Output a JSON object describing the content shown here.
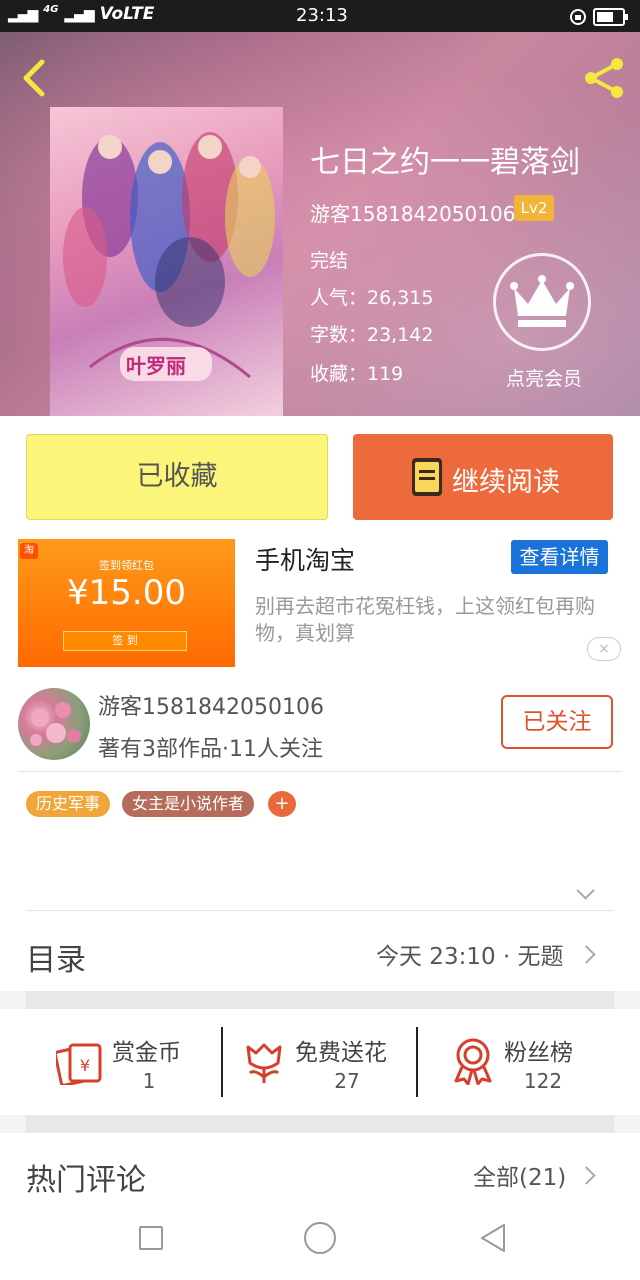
{
  "status_bar": {
    "network": "VoLTE",
    "signal_label": "4G",
    "time": "23:13"
  },
  "book": {
    "title": "七日之约一一碧落剑",
    "author": "游客1581842050106",
    "level": "Lv2",
    "status": "完结",
    "popularity": "人气：26,315",
    "word_count": "字数：23,142",
    "favorites": "收藏：119",
    "cover_logo": "叶罗丽"
  },
  "vip": {
    "label": "点亮会员"
  },
  "actions": {
    "collected": "已收藏",
    "continue_reading": "继续阅读"
  },
  "ad": {
    "title": "手机淘宝",
    "button": "查看详情",
    "description": "别再去超市花冤枉钱，上这领红包再购物，真划算",
    "image_caption": "签到领红包",
    "image_price": "¥15.00",
    "image_button": "签 到",
    "close": "×"
  },
  "author_card": {
    "name": "游客1581842050106",
    "stats": "著有3部作品·11人关注",
    "follow": "已关注"
  },
  "tags": [
    "历史军事",
    "女主是小说作者"
  ],
  "tag_add": "+",
  "catalog": {
    "title": "目录",
    "latest": "今天 23:10 · 无题"
  },
  "stats": [
    {
      "label": "赏金币",
      "value": "1",
      "icon": "red-envelope-icon"
    },
    {
      "label": "免费送花",
      "value": "27",
      "icon": "flower-icon"
    },
    {
      "label": "粉丝榜",
      "value": "122",
      "icon": "medal-icon"
    }
  ],
  "comments": {
    "title": "热门评论",
    "all": "全部(21)"
  },
  "colors": {
    "accent": "#ec6a3c",
    "collect_bg": "#fbf57a",
    "ad_button": "#1a73d9",
    "level_badge": "#f0b43a",
    "icon_red": "#d6402a"
  }
}
